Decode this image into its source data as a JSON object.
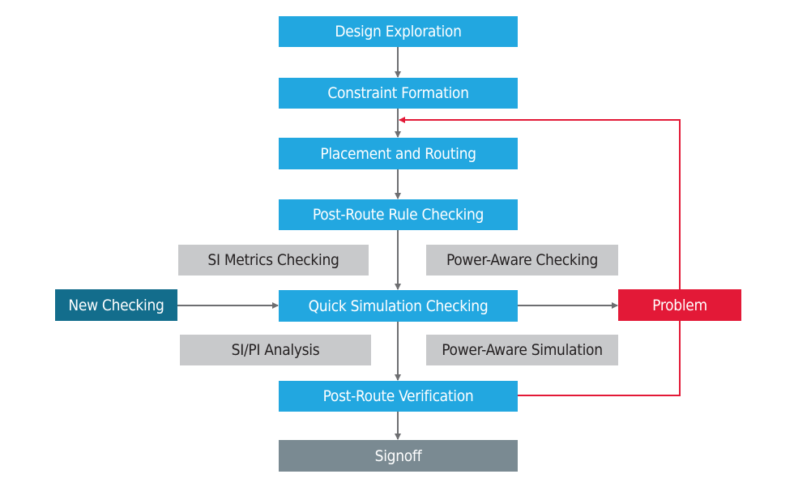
{
  "colors": {
    "process": "#22a7e0",
    "input": "#136d8c",
    "problem": "#e31937",
    "analysis": "#c8c9cb",
    "signoff": "#7a8a92",
    "arrow": "#6d6e71",
    "feedback": "#e31937"
  },
  "nodes": {
    "design_exploration": "Design Exploration",
    "constraint_formation": "Constraint Formation",
    "placement_routing": "Placement and Routing",
    "post_route_rule": "Post-Route Rule Checking",
    "si_metrics": "SI Metrics Checking",
    "power_aware_checking": "Power-Aware Checking",
    "new_checking": "New Checking",
    "quick_sim": "Quick Simulation Checking",
    "problem": "Problem",
    "si_pi": "SI/PI Analysis",
    "power_aware_sim": "Power-Aware Simulation",
    "post_route_verif": "Post-Route Verification",
    "signoff": "Signoff"
  }
}
